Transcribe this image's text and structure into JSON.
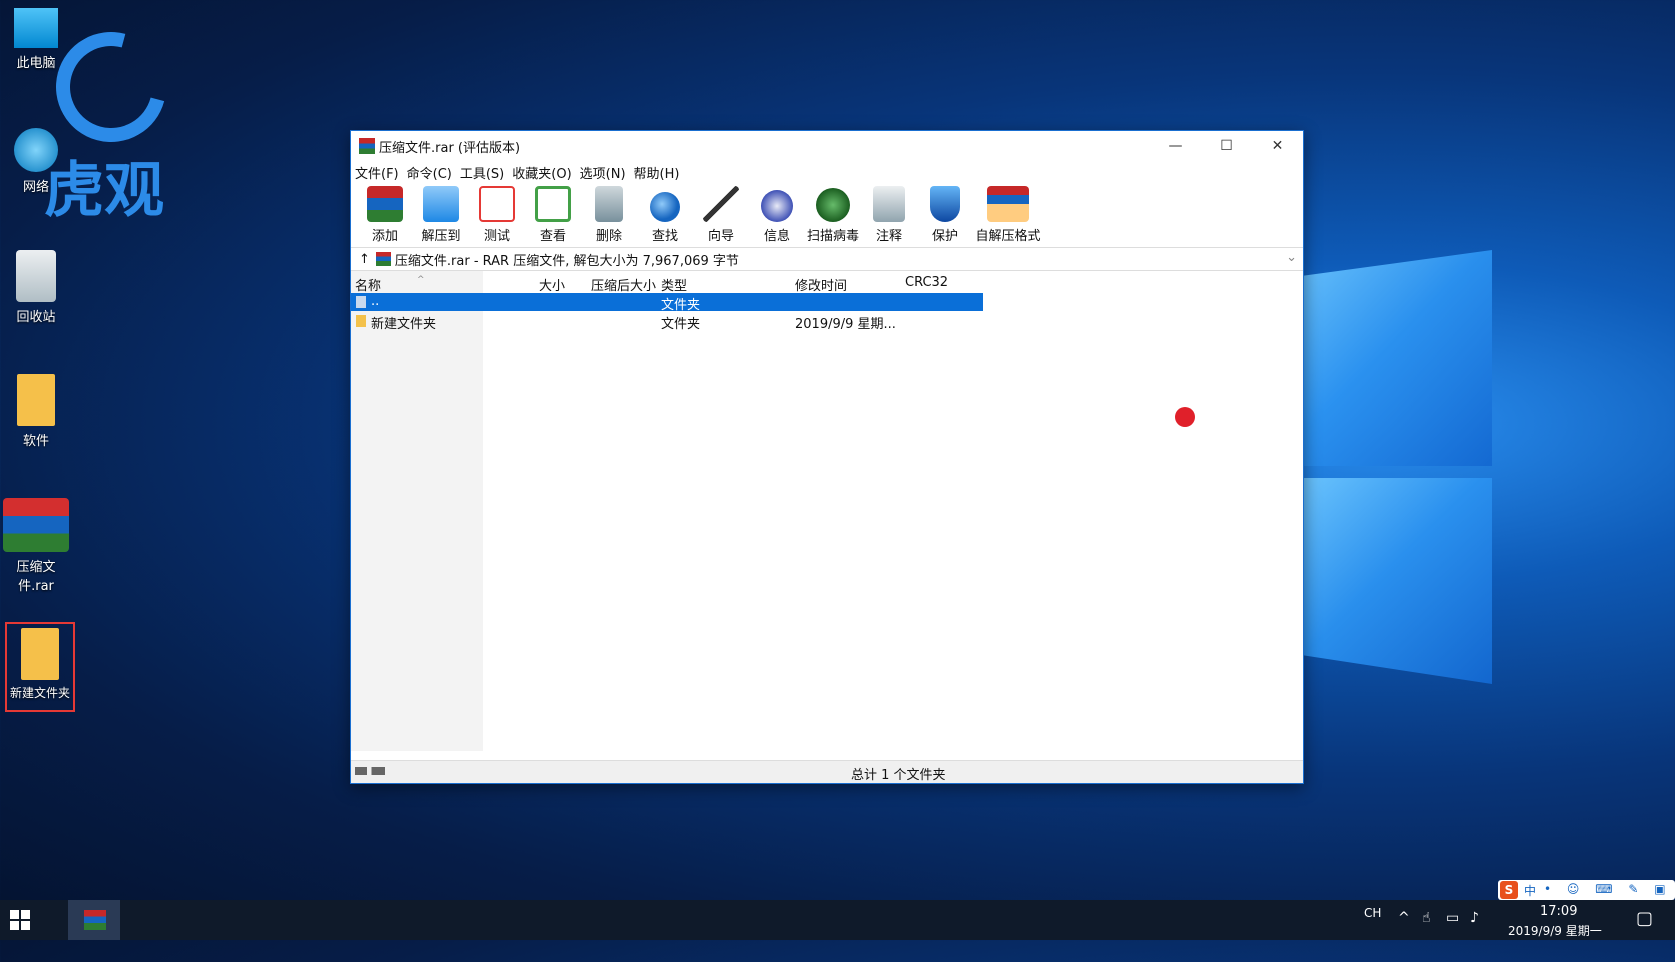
{
  "desktop": {
    "brand_text": "虎观",
    "icons": [
      {
        "label": "此电脑",
        "icon": "computer-icon"
      },
      {
        "label": "网络",
        "icon": "network-icon"
      },
      {
        "label": "回收站",
        "icon": "recycle-bin-icon"
      },
      {
        "label": "软件",
        "icon": "folder-icon"
      },
      {
        "label": "压缩文件.rar",
        "icon": "winrar-archive-icon"
      },
      {
        "label": "新建文件夹",
        "icon": "folder-icon"
      }
    ]
  },
  "window": {
    "title": "压缩文件.rar (评估版本)",
    "controls": {
      "minimize": "—",
      "maximize": "☐",
      "close": "✕"
    },
    "menu": [
      "文件(F)",
      "命令(C)",
      "工具(S)",
      "收藏夹(O)",
      "选项(N)",
      "帮助(H)"
    ],
    "toolbar": [
      {
        "label": "添加",
        "icon": "add-archive-icon",
        "color": "#c62828"
      },
      {
        "label": "解压到",
        "icon": "extract-folder-icon",
        "color": "#42a5f5"
      },
      {
        "label": "测试",
        "icon": "test-clipboard-icon",
        "color": "#e53935"
      },
      {
        "label": "查看",
        "icon": "view-book-icon",
        "color": "#43a047"
      },
      {
        "label": "删除",
        "icon": "trash-icon",
        "color": "#90a4ae"
      },
      {
        "label": "查找",
        "icon": "magnifier-icon",
        "color": "#1e88e5"
      },
      {
        "label": "向导",
        "icon": "wizard-wand-icon",
        "color": "#7cb342"
      },
      {
        "label": "信息",
        "icon": "info-icon",
        "color": "#3f51b5"
      },
      {
        "label": "扫描病毒",
        "icon": "virus-scan-icon",
        "color": "#2e7d32"
      },
      {
        "label": "注释",
        "icon": "comment-icon",
        "color": "#78909c"
      },
      {
        "label": "保护",
        "icon": "shield-icon",
        "color": "#1565c0"
      },
      {
        "label": "自解压格式",
        "icon": "sfx-box-icon",
        "color": "#ef6c00"
      }
    ],
    "address": "压缩文件.rar - RAR 压缩文件, 解包大小为 7,967,069 字节",
    "columns": [
      "名称",
      "大小",
      "压缩后大小",
      "类型",
      "修改时间",
      "CRC32"
    ],
    "rows": [
      {
        "name": "..",
        "size": "",
        "packed": "",
        "type": "文件夹",
        "modified": "",
        "crc": "",
        "selected": true
      },
      {
        "name": "新建文件夹",
        "size": "",
        "packed": "",
        "type": "文件夹",
        "modified": "2019/9/9 星期...",
        "crc": "",
        "selected": false
      }
    ],
    "status": "总计 1 个文件夹"
  },
  "taskbar": {
    "lang": "CH",
    "time": "17:09",
    "date": "2019/9/9 星期一",
    "ime_label": "中"
  },
  "colors": {
    "selection": "#0a6fd8",
    "accent": "#1a6fd0",
    "highlight_box": "#e53935"
  }
}
